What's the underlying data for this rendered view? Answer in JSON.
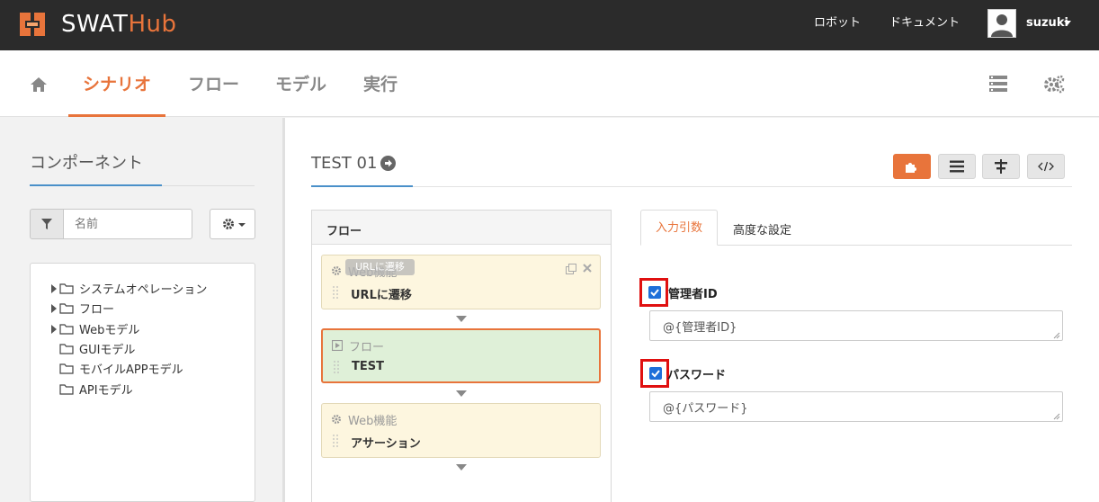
{
  "header": {
    "logo_main": "SWAT",
    "logo_accent": "Hub",
    "links": {
      "robot": "ロボット",
      "document": "ドキュメント"
    },
    "user": "suzuki"
  },
  "nav": {
    "items": [
      "シナリオ",
      "フロー",
      "モデル",
      "実行"
    ],
    "active": "シナリオ"
  },
  "components": {
    "title": "コンポーネント",
    "filter_placeholder": "名前",
    "tree": [
      {
        "label": "システムオペレーション",
        "expandable": true
      },
      {
        "label": "フロー",
        "expandable": true
      },
      {
        "label": "Webモデル",
        "expandable": true
      },
      {
        "label": "GUIモデル",
        "expandable": false
      },
      {
        "label": "モバイルAPPモデル",
        "expandable": false
      },
      {
        "label": "APIモデル",
        "expandable": false
      }
    ]
  },
  "scenario": {
    "title": "TEST 01"
  },
  "flow": {
    "header": "フロー",
    "tooltip": "URLに遷移",
    "cards": [
      {
        "type": "Web機能",
        "name": "URLに遷移"
      },
      {
        "type": "フロー",
        "name": "TEST"
      },
      {
        "type": "Web機能",
        "name": "アサーション"
      }
    ]
  },
  "params": {
    "tabs": [
      "入力引数",
      "高度な設定"
    ],
    "fields": [
      {
        "label": "管理者ID",
        "checked": true,
        "value": "@{管理者ID}"
      },
      {
        "label": "パスワード",
        "checked": true,
        "value": "@{パスワード}"
      }
    ]
  },
  "colors": {
    "accent": "#e8743b",
    "topbar": "#2b2b2b",
    "selected_card": "#dff0d8",
    "card": "#fdf6df",
    "highlight": "#e01010"
  }
}
